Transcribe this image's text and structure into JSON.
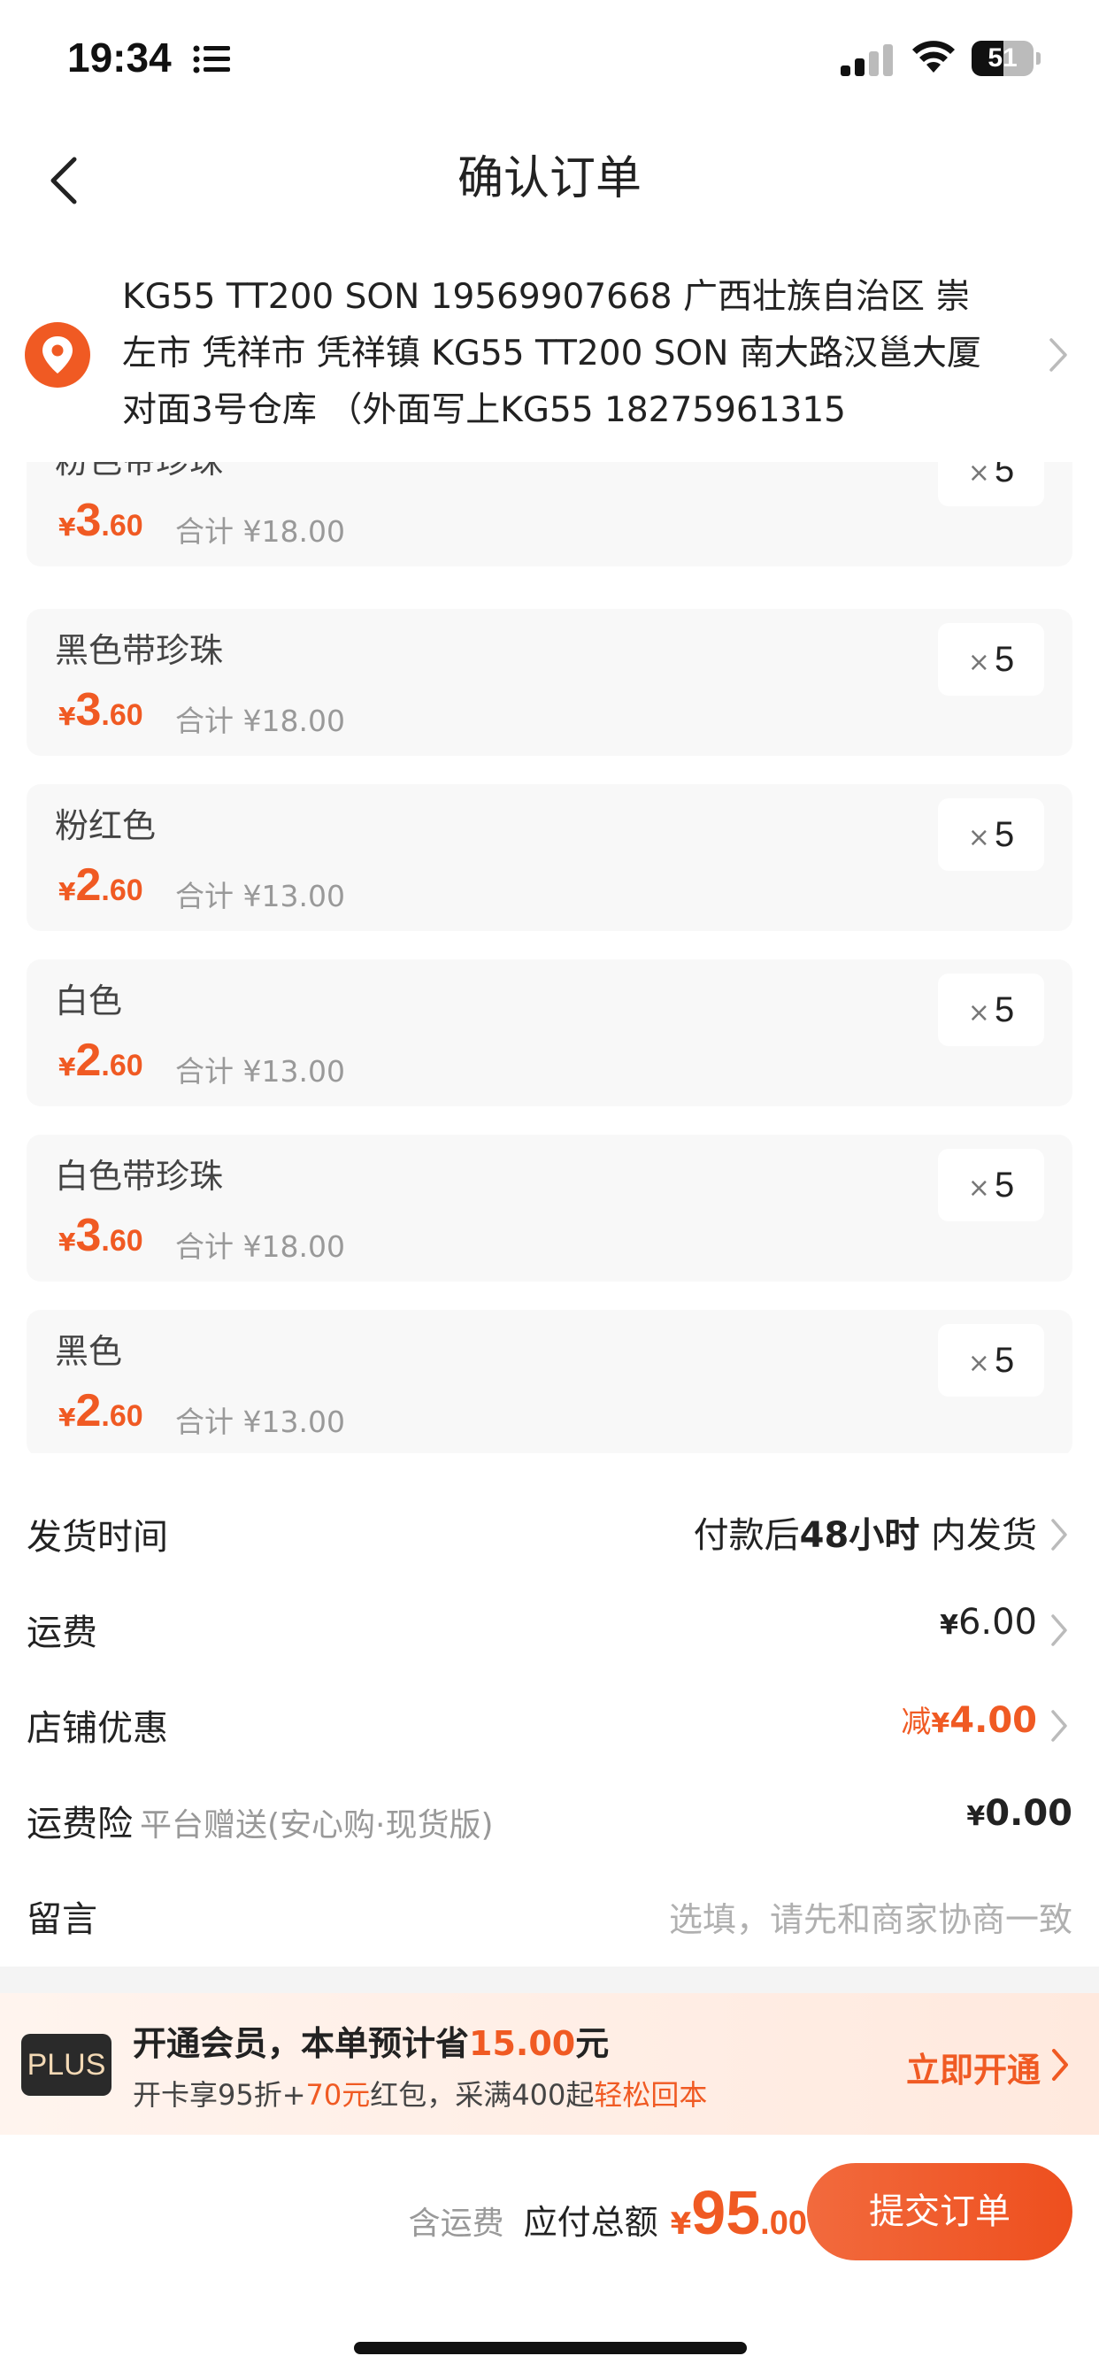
{
  "status_bar": {
    "time": "19:34",
    "battery": "51",
    "battery_level": 0.51,
    "icons": [
      "list-icon",
      "signal-icon",
      "wifi-icon",
      "battery-icon"
    ]
  },
  "nav": {
    "title": "确认订单",
    "back_icon": "chevron-left-icon"
  },
  "address": {
    "text": "KG55 TT200 SON 19569907668 广西壮族自治区 崇左市 凭祥市 凭祥镇 KG55 TT200 SON 南大路汉邕大厦对面3号仓库 （外面写上KG55 18275961315",
    "icon": "location-pin-icon"
  },
  "items": [
    {
      "name": "粉色带珍珠",
      "price_symbol": "¥",
      "price_int": "3",
      "price_dec": ".60",
      "subtotal": "合计 ¥18.00",
      "qty_x": "×",
      "qty": "5"
    },
    {
      "name": "黑色带珍珠",
      "price_symbol": "¥",
      "price_int": "3",
      "price_dec": ".60",
      "subtotal": "合计 ¥18.00",
      "qty_x": "×",
      "qty": "5"
    },
    {
      "name": "粉红色",
      "price_symbol": "¥",
      "price_int": "2",
      "price_dec": ".60",
      "subtotal": "合计 ¥13.00",
      "qty_x": "×",
      "qty": "5"
    },
    {
      "name": "白色",
      "price_symbol": "¥",
      "price_int": "2",
      "price_dec": ".60",
      "subtotal": "合计 ¥13.00",
      "qty_x": "×",
      "qty": "5"
    },
    {
      "name": "白色带珍珠",
      "price_symbol": "¥",
      "price_int": "3",
      "price_dec": ".60",
      "subtotal": "合计 ¥18.00",
      "qty_x": "×",
      "qty": "5"
    },
    {
      "name": "黑色",
      "price_symbol": "¥",
      "price_int": "2",
      "price_dec": ".60",
      "subtotal": "合计 ¥13.00",
      "qty_x": "×",
      "qty": "5"
    }
  ],
  "shipping_time": {
    "label": "发货时间",
    "prefix": "付款后",
    "highlight": "48小时",
    "suffix": "内发货"
  },
  "freight": {
    "label": "运费",
    "symbol": "¥",
    "amount": "6.00"
  },
  "store_discount": {
    "label": "店铺优惠",
    "prefix": "减",
    "symbol": "¥",
    "amount": "4.00"
  },
  "freight_insurance": {
    "label": "运费险",
    "sub": "平台赠送(安心购·现货版)",
    "symbol": "¥",
    "amount": "0.00"
  },
  "message": {
    "label": "留言",
    "placeholder": "选填，请先和商家协商一致"
  },
  "plus": {
    "logo": "PLUS",
    "title_prefix": "开通会员，本单预计省",
    "title_amount": "15.00",
    "title_suffix": "元",
    "desc_prefix": "开卡享95折+",
    "desc_amount": "70元",
    "desc_mid": "红包，采满400起",
    "desc_highlight": "轻松回本",
    "cta": "立即开通"
  },
  "bottom": {
    "note": "含运费",
    "label": "应付总额",
    "symbol": "¥",
    "total_int": "95",
    "total_dec": ".00",
    "submit": "提交订单"
  },
  "colors": {
    "accent": "#f05a23",
    "card_bg": "#f8f8f8",
    "muted_text": "#999999"
  }
}
